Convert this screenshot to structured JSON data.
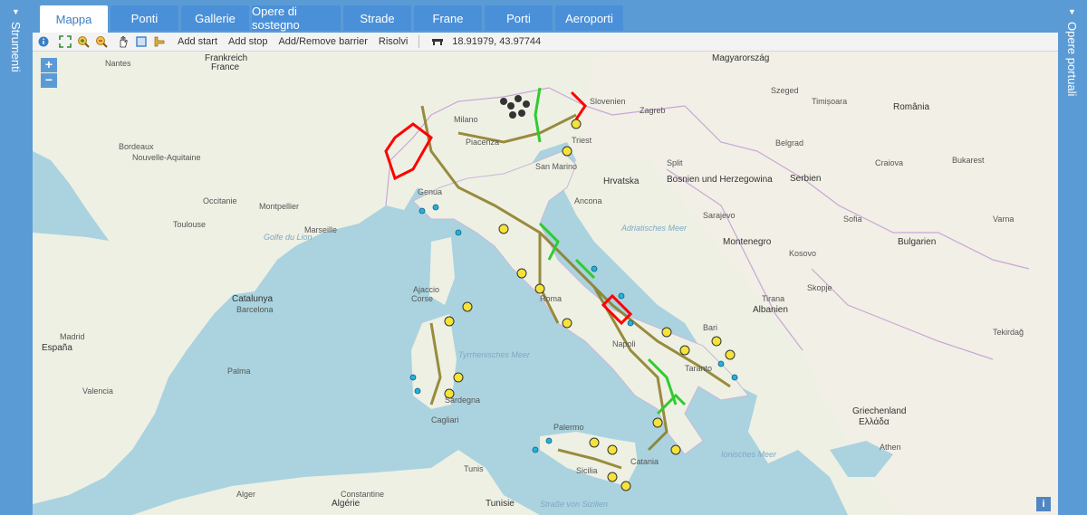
{
  "left_panel": {
    "label": "Strumenti"
  },
  "right_panel": {
    "label": "Opere portuali"
  },
  "tabs": [
    {
      "label": "Mappa"
    },
    {
      "label": "Ponti"
    },
    {
      "label": "Gallerie"
    },
    {
      "label": "Opere di sostegno"
    },
    {
      "label": "Strade"
    },
    {
      "label": "Frane"
    },
    {
      "label": "Porti"
    },
    {
      "label": "Aeroporti"
    }
  ],
  "toolbar": {
    "add_start": "Add start",
    "add_stop": "Add stop",
    "add_remove_barrier": "Add/Remove barrier",
    "solve": "Risolvi",
    "coords": "18.91979, 43.97744"
  },
  "zoom": {
    "in": "+",
    "out": "−"
  },
  "info": "i",
  "map_labels": {
    "nantes": "Nantes",
    "frankreich": "Frankreich",
    "france": "France",
    "bordeaux": "Bordeaux",
    "aquitaine": "Nouvelle-Aquitaine",
    "occitanie": "Occitanie",
    "montpellier": "Montpellier",
    "marseille": "Marseille",
    "toulouse": "Toulouse",
    "genova": "Genua",
    "milano": "Milano",
    "piacenza": "Piacenza",
    "san_marino": "San Marino",
    "ancona": "Ancona",
    "roma": "Roma",
    "napoli": "Napoli",
    "bari": "Bari",
    "taranto": "Taranto",
    "palermo": "Palermo",
    "catania": "Catania",
    "cagliari": "Cagliari",
    "ajaccio": "Ajaccio",
    "corse": "Corse",
    "sardegna": "Sardegna",
    "sicilia": "Sicilia",
    "barcelona": "Barcelona",
    "catalunya": "Catalunya",
    "espana": "España",
    "madrid": "Madrid",
    "valencia": "Valencia",
    "palma": "Palma",
    "algerie": "Algérie",
    "alger": "Alger",
    "tunis": "Tunis",
    "tunisie": "Tunisie",
    "constantine": "Constantine",
    "zagreb": "Zagreb",
    "hrvatska": "Hrvatska",
    "bosnia": "Bosnien und Herzegowina",
    "sarajevo": "Sarajevo",
    "serbia": "Serbien",
    "beograd": "Belgrad",
    "montenegro": "Montenegro",
    "kosovo": "Kosovo",
    "albania": "Albanien",
    "tirana": "Tirana",
    "skopje": "Skopje",
    "bulgaria": "Bulgarien",
    "sofia": "Sofia",
    "romania": "România",
    "bucuresti": "Bukarest",
    "hellas": "Ελλάδα",
    "athen": "Athen",
    "greece": "Griechenland",
    "magyar": "Magyarország",
    "slovenia": "Slovenien",
    "szeged": "Szeged",
    "timisoara": "Timișoara",
    "craiova": "Craiova",
    "varna": "Varna",
    "tekirdag": "Tekirdağ",
    "triest": "Triest",
    "split": "Split",
    "gulf_lion": "Golfe du Lion",
    "tyrrhen": "Tyrrhenisches Meer",
    "adria": "Adriatisches Meer",
    "ionian": "Ionisches Meer",
    "sicily_strait": "Straße von Sizilien"
  }
}
